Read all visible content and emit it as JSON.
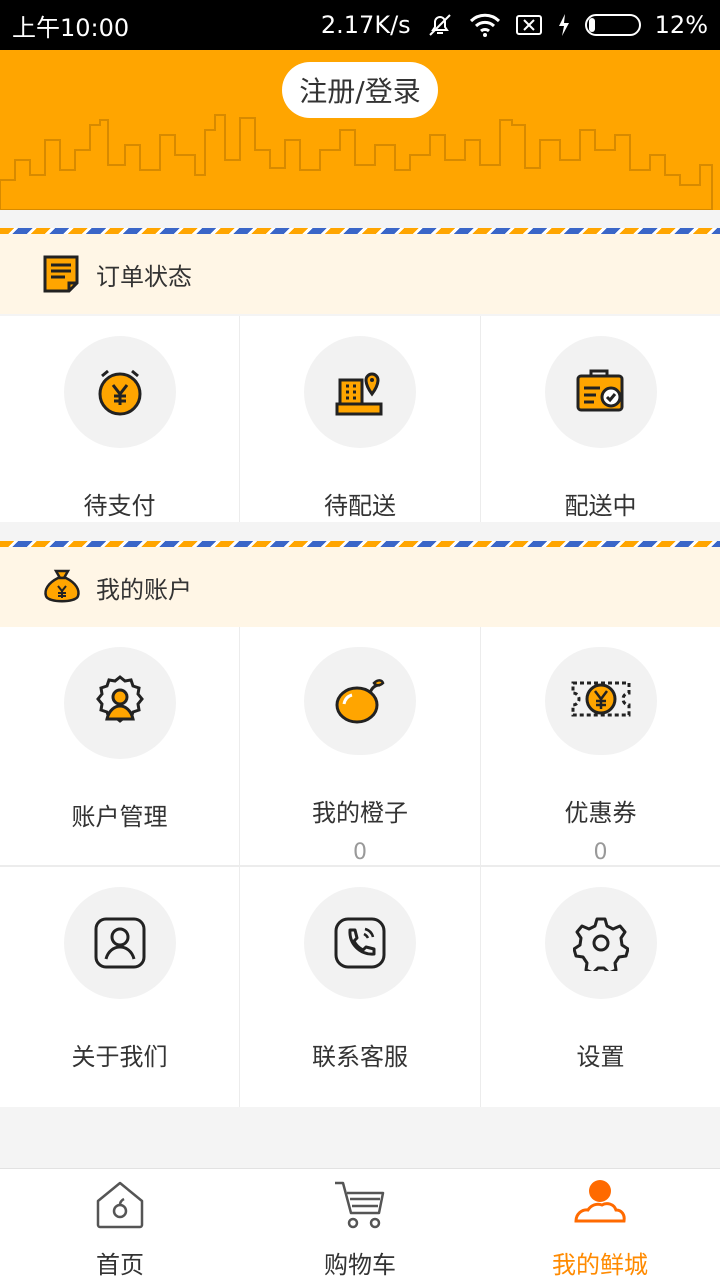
{
  "status_bar": {
    "time": "上午10:00",
    "speed": "2.17K/s",
    "battery_percent": "12%",
    "battery_level": 0.12
  },
  "header": {
    "login_label": "注册/登录",
    "bg_color": "#ffa500"
  },
  "order_section": {
    "title": "订单状态",
    "items": [
      {
        "label": "待支付",
        "icon": "alarm-yen-icon"
      },
      {
        "label": "待配送",
        "icon": "warehouse-location-icon"
      },
      {
        "label": "配送中",
        "icon": "delivery-clipboard-icon"
      }
    ]
  },
  "account_section": {
    "title": "我的账户",
    "items": [
      {
        "label": "账户管理",
        "icon": "user-gear-icon"
      },
      {
        "label": "我的橙子",
        "count": "0",
        "icon": "orange-fruit-icon"
      },
      {
        "label": "优惠券",
        "count": "0",
        "icon": "coupon-yen-icon"
      },
      {
        "label": "关于我们",
        "icon": "user-card-icon"
      },
      {
        "label": "联系客服",
        "icon": "phone-call-icon"
      },
      {
        "label": "设置",
        "icon": "settings-gear-icon"
      }
    ]
  },
  "tabbar": {
    "tabs": [
      {
        "label": "首页",
        "icon": "home-icon"
      },
      {
        "label": "购物车",
        "icon": "cart-icon"
      },
      {
        "label": "我的鲜城",
        "icon": "profile-icon",
        "active": true
      }
    ],
    "active_color": "#ff8a00"
  }
}
